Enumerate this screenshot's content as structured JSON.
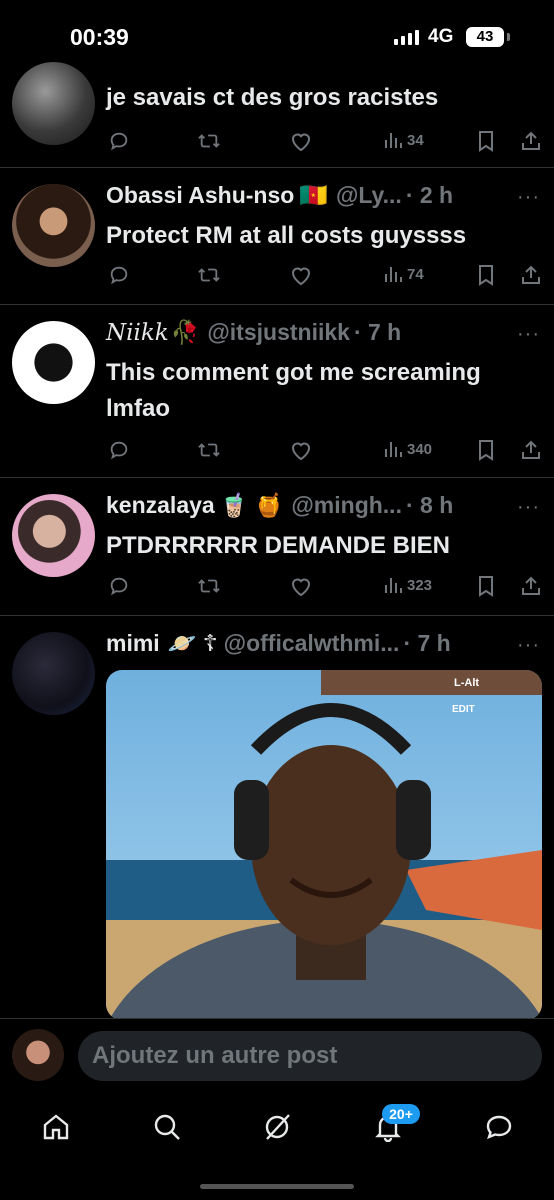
{
  "status_bar": {
    "time": "00:39",
    "network": "4G",
    "battery": "43"
  },
  "posts": [
    {
      "name": "",
      "handle": "",
      "time": "",
      "text": "je savais ct des gros racistes",
      "views": "34"
    },
    {
      "name": "Obassi Ashu-nso",
      "emoji": "🇨🇲",
      "handle": "@Ly...",
      "time": "· 2 h",
      "text": "Protect RM at all costs guyssss",
      "views": "74"
    },
    {
      "name": "Niikk",
      "emoji": "🥀",
      "handle": "@itsjustniikk",
      "time": "· 7 h",
      "text_line1": "This comment got me screaming",
      "text_line2": "lmfao",
      "views": "340"
    },
    {
      "name": "kenzalaya",
      "emoji": "🧋 🍯",
      "handle": "@mingh...",
      "time": "· 8 h",
      "text": "PTDRRRRRR DEMANDE BIEN",
      "views": "323"
    },
    {
      "name": "mimi",
      "emoji": "🪐 ☦",
      "handle": "@officalwthmi...",
      "time": "· 7 h",
      "media_caption": "L-Alt",
      "media_caption2": "EDIT"
    }
  ],
  "more_glyph": "···",
  "reply": {
    "placeholder": "Ajoutez un autre post"
  },
  "nav": {
    "items": [
      "home-icon",
      "search-icon",
      "grok-icon",
      "notifications-icon",
      "messages-icon"
    ],
    "notification_badge": "20+"
  },
  "colors": {
    "background": "#000000",
    "text": "#e7e9ea",
    "muted": "#71767b",
    "accent": "#1d9bf0"
  }
}
